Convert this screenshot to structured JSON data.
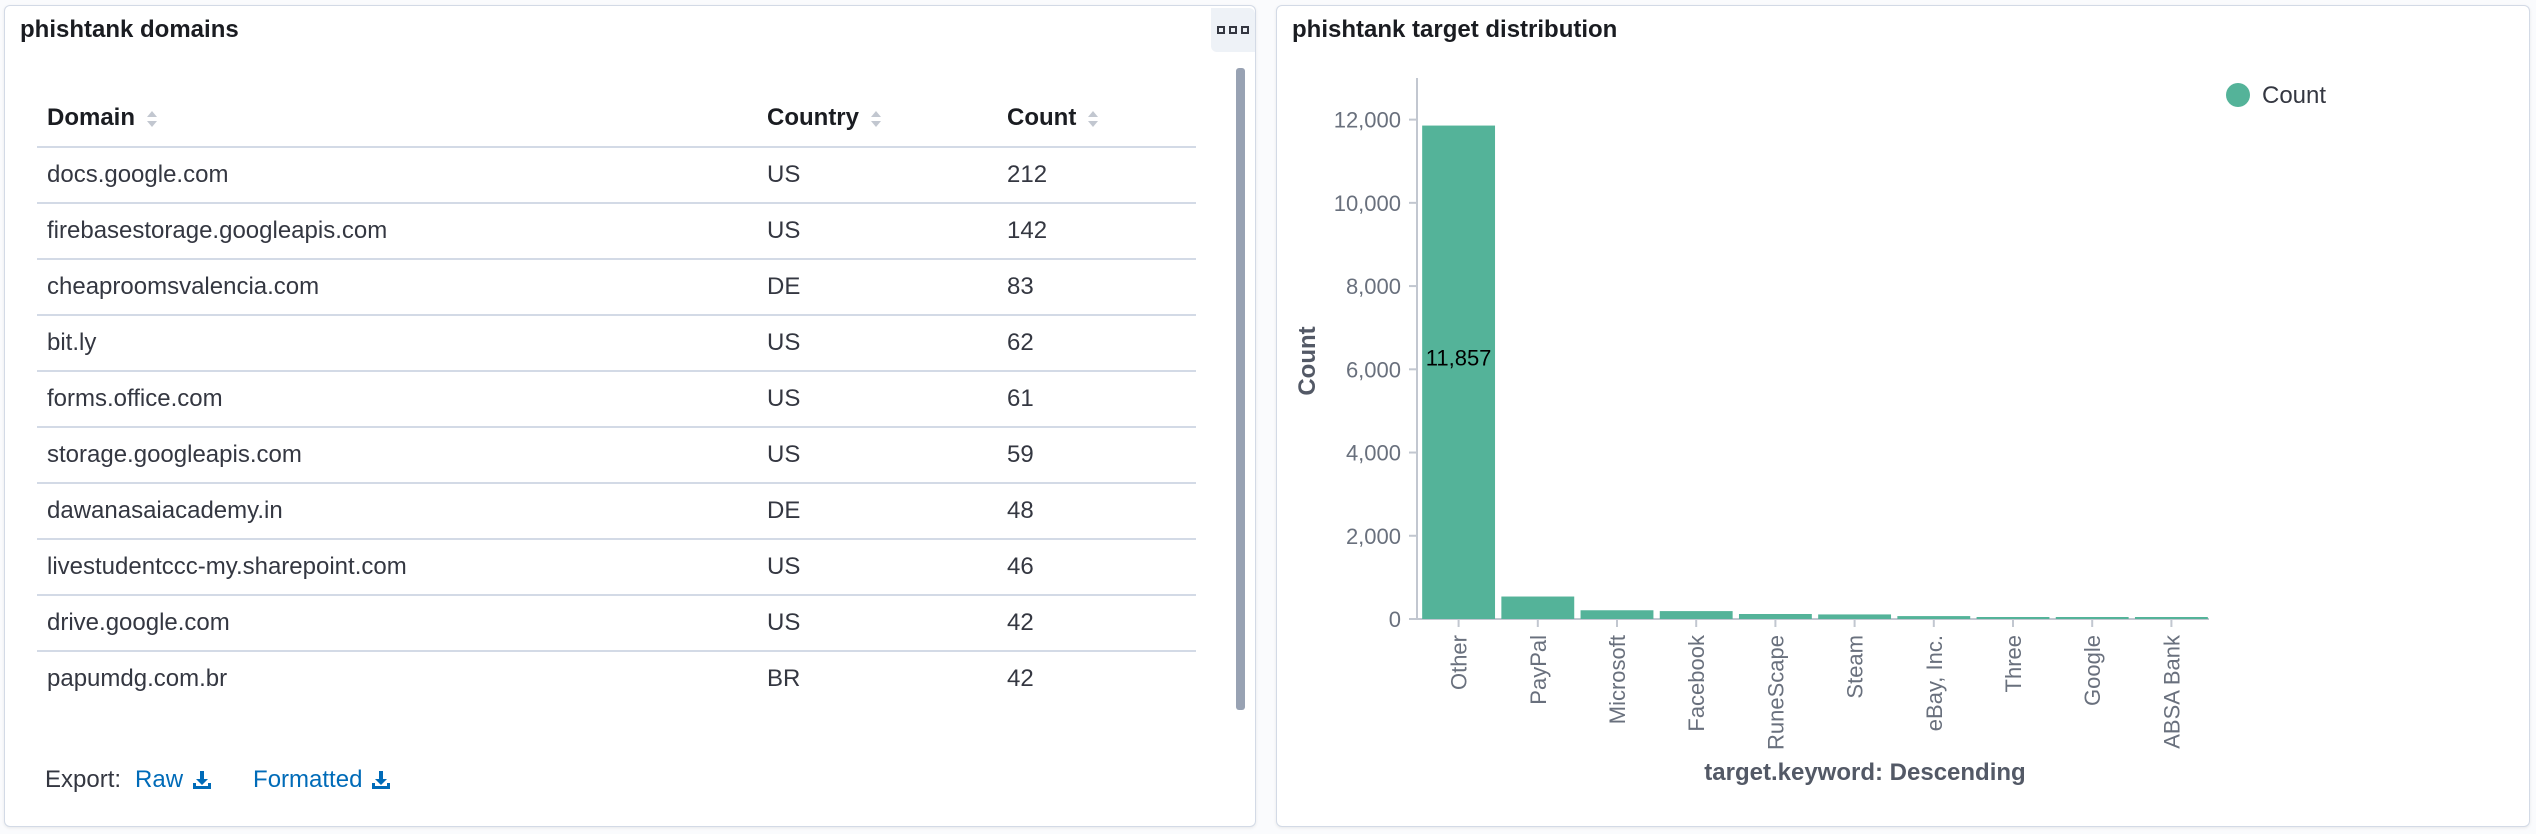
{
  "left_panel": {
    "title": "phishtank domains",
    "columns": [
      "Domain",
      "Country",
      "Count"
    ],
    "rows": [
      [
        "docs.google.com",
        "US",
        "212"
      ],
      [
        "firebasestorage.googleapis.com",
        "US",
        "142"
      ],
      [
        "cheaproomsvalencia.com",
        "DE",
        "83"
      ],
      [
        "bit.ly",
        "US",
        "62"
      ],
      [
        "forms.office.com",
        "US",
        "61"
      ],
      [
        "storage.googleapis.com",
        "US",
        "59"
      ],
      [
        "dawanasaiacademy.in",
        "DE",
        "48"
      ],
      [
        "livestudentccc-my.sharepoint.com",
        "US",
        "46"
      ],
      [
        "drive.google.com",
        "US",
        "42"
      ],
      [
        "papumdg.com.br",
        "BR",
        "42"
      ]
    ],
    "export_label": "Export:",
    "export_raw": "Raw",
    "export_formatted": "Formatted"
  },
  "right_panel": {
    "title": "phishtank target distribution"
  },
  "chart_data": {
    "type": "bar",
    "categories": [
      "Other",
      "PayPal",
      "Microsoft",
      "Facebook",
      "RuneScape",
      "Steam",
      "eBay, Inc.",
      "Three",
      "Google",
      "ABSA Bank"
    ],
    "series": [
      {
        "name": "Count",
        "values": [
          11857,
          540,
          210,
          190,
          120,
          110,
          70,
          30,
          25,
          20
        ],
        "color": "#54b399"
      }
    ],
    "data_labels": [
      "11,857"
    ],
    "xlabel": "target.keyword: Descending",
    "ylabel": "Count",
    "ylim": [
      0,
      13000
    ],
    "yticks": [
      0,
      2000,
      4000,
      6000,
      8000,
      10000,
      12000
    ],
    "ytick_labels": [
      "0",
      "2,000",
      "4,000",
      "6,000",
      "8,000",
      "10,000",
      "12,000"
    ],
    "legend_position": "top-right",
    "grid": false
  },
  "colors": {
    "bar": "#54b399",
    "link": "#006bb8",
    "border": "#d3dae6"
  }
}
